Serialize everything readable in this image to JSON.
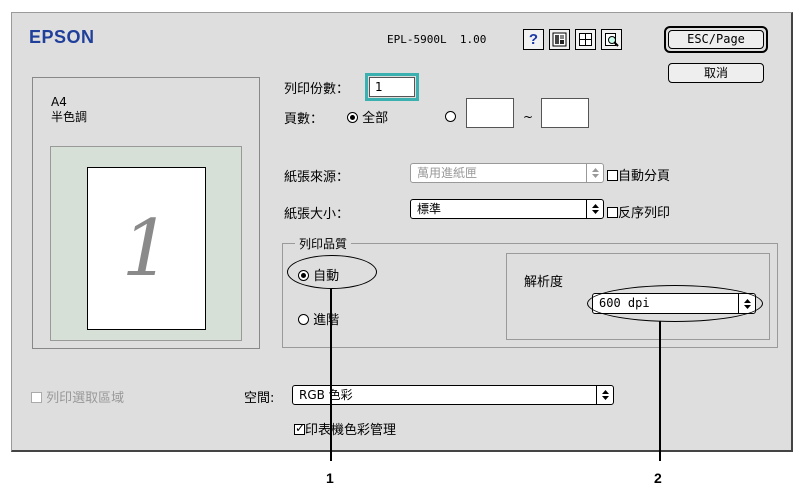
{
  "header": {
    "logo": "EPSON",
    "model": "EPL-5900L",
    "version": "1.00",
    "icons": [
      "help-icon",
      "settings-icon",
      "layout-icon",
      "preview-icon"
    ],
    "esc_button": "ESC/Page",
    "cancel_button": "取消"
  },
  "preview": {
    "paper": "A4",
    "mode": "半色調",
    "page_number": "1"
  },
  "copies": {
    "label": "列印份數：",
    "value": "1"
  },
  "pages": {
    "label": "頁數：",
    "all_label": "全部",
    "range_separator": "~",
    "from": "",
    "to": ""
  },
  "paper_source": {
    "label": "紙張來源：",
    "value": "萬用進紙匣",
    "collate_label": "自動分頁"
  },
  "paper_size": {
    "label": "紙張大小：",
    "value": "標準",
    "reverse_label": "反序列印"
  },
  "quality": {
    "group_title": "列印品質",
    "auto_label": "自動",
    "advanced_label": "進階",
    "resolution_label": "解析度",
    "resolution_value": "600 dpi"
  },
  "bottom": {
    "print_selection_label": "列印選取區域",
    "space_label": "空間:",
    "space_value": "RGB 色彩",
    "color_mgmt_label": "印表機色彩管理"
  },
  "callouts": {
    "one": "1",
    "two": "2"
  },
  "colors": {
    "logo": "#1f3f9b",
    "copies_focus": "#3ab0b0",
    "dialog_bg": "#dedede"
  }
}
